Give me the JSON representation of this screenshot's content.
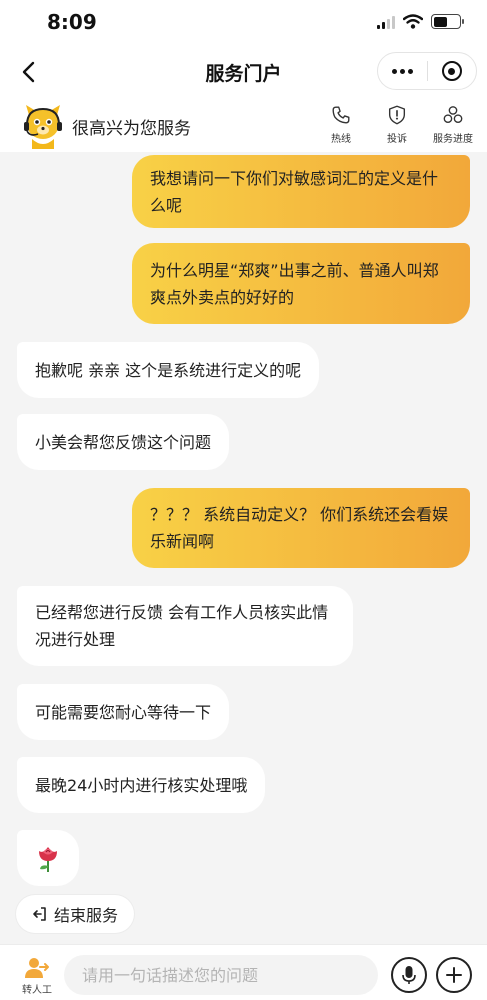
{
  "status_bar": {
    "time": "8:09"
  },
  "nav": {
    "title": "服务门户"
  },
  "service_header": {
    "welcome": "很高兴为您服务",
    "actions": [
      {
        "label": "热线",
        "icon": "phone-icon"
      },
      {
        "label": "投诉",
        "icon": "shield-alert-icon"
      },
      {
        "label": "服务进度",
        "icon": "progress-icon"
      }
    ]
  },
  "messages": [
    {
      "from": "user",
      "text": "我想请问一下你们对敏感词汇的定义是什么呢"
    },
    {
      "from": "user",
      "text": "为什么明星“郑爽”出事之前、普通人叫郑爽点外卖点的好好的"
    },
    {
      "from": "bot",
      "text": "抱歉呢 亲亲 这个是系统进行定义的呢"
    },
    {
      "from": "bot",
      "text": "小美会帮您反馈这个问题"
    },
    {
      "from": "user",
      "text": "？？？ 系统自动定义？ 你们系统还会看娱乐新闻啊"
    },
    {
      "from": "bot",
      "text": "已经帮您进行反馈 会有工作人员核实此情况进行处理"
    },
    {
      "from": "bot",
      "text": "可能需要您耐心等待一下"
    },
    {
      "from": "bot",
      "text": "最晚24小时内进行核实处理哦"
    },
    {
      "from": "bot",
      "text": "",
      "emoji": "rose-icon"
    }
  ],
  "end_service": {
    "label": "结束服务"
  },
  "input_bar": {
    "transfer_label": "转人工",
    "placeholder": "请用一句话描述您的问题"
  },
  "colors": {
    "user_bubble_start": "#f8d146",
    "user_bubble_end": "#f2a83a",
    "bot_bubble": "#ffffff",
    "background": "#f4f4f4"
  }
}
